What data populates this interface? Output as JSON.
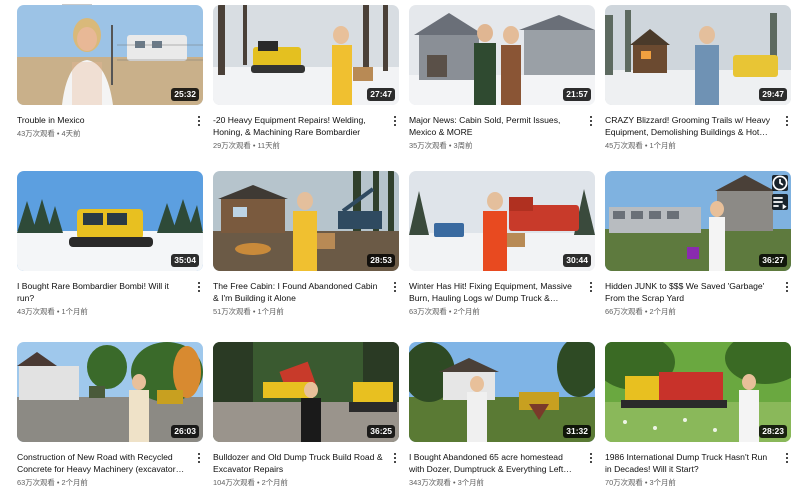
{
  "videos": [
    {
      "title": "Trouble in Mexico",
      "views": "43万次观看",
      "age": "4天前",
      "duration": "25:32"
    },
    {
      "title": "-20 Heavy Equipment Repairs! Welding, Honing, & Machining Rare Bombardier",
      "views": "29万次观看",
      "age": "11天前",
      "duration": "27:47"
    },
    {
      "title": "Major News: Cabin Sold, Permit Issues, Mexico & MORE",
      "views": "35万次观看",
      "age": "3周前",
      "duration": "21:57"
    },
    {
      "title": "CRAZY Blizzard! Grooming Trails w/ Heavy Equipment, Demolishing Buildings & Hot…",
      "views": "45万次观看",
      "age": "1个月前",
      "duration": "29:47"
    },
    {
      "title": "I Bought Rare Bombardier Bombi! Will it run?",
      "views": "43万次观看",
      "age": "1个月前",
      "duration": "35:04"
    },
    {
      "title": "The Free Cabin: I Found Abandoned Cabin & I'm Building it Alone",
      "views": "51万次观看",
      "age": "1个月前",
      "duration": "28:53"
    },
    {
      "title": "Winter Has Hit! Fixing Equipment, Massive Burn, Hauling Logs w/ Dump Truck &…",
      "views": "63万次观看",
      "age": "2个月前",
      "duration": "30:44"
    },
    {
      "title": "Hidden JUNK to $$$ We Saved 'Garbage' From the Scrap Yard",
      "views": "66万次观看",
      "age": "2个月前",
      "duration": "36:27"
    },
    {
      "title": "Construction of New Road with Recycled Concrete for Heavy Machinery (excavator &…",
      "views": "63万次观看",
      "age": "2个月前",
      "duration": "26:03"
    },
    {
      "title": "Bulldozer and Old Dump Truck Build Road & Excavator Repairs",
      "views": "104万次观看",
      "age": "2个月前",
      "duration": "36:25"
    },
    {
      "title": "I Bought Abandoned 65 acre homestead with Dozer, Dumptruck & Everything Left Behind…",
      "views": "343万次观看",
      "age": "3个月前",
      "duration": "31:32"
    },
    {
      "title": "1986 International Dump Truck Hasn't Run in Decades! Will it Start?",
      "views": "70万次观看",
      "age": "3个月前",
      "duration": "28:23"
    }
  ],
  "hover_icons": [
    "clock-icon",
    "queue-icon"
  ],
  "colors": {
    "text": "#0f0f0f",
    "secondary": "#606060",
    "badge": "#000000"
  }
}
